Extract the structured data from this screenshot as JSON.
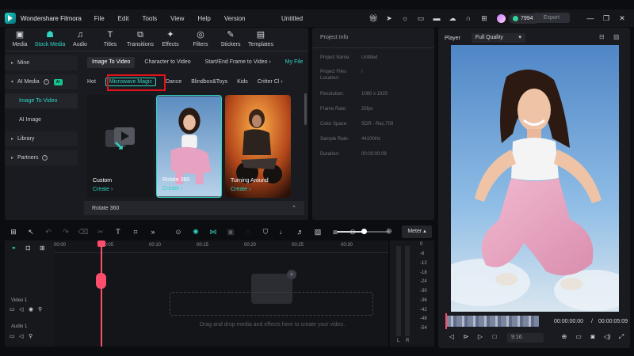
{
  "app": {
    "name": "Wondershare Filmora",
    "doc_title": "Untitled",
    "credits": "79943",
    "export_label": "Export"
  },
  "menu": [
    "File",
    "Edit",
    "Tools",
    "View",
    "Help",
    "Version"
  ],
  "toolbar_tabs": [
    {
      "label": "Media",
      "icon": "media-icon",
      "glyph": "▣"
    },
    {
      "label": "Stock Media",
      "icon": "stock-media-icon",
      "glyph": "☗"
    },
    {
      "label": "Audio",
      "icon": "audio-icon",
      "glyph": "♫"
    },
    {
      "label": "Titles",
      "icon": "titles-icon",
      "glyph": "T"
    },
    {
      "label": "Transitions",
      "icon": "transitions-icon",
      "glyph": "⧉"
    },
    {
      "label": "Effects",
      "icon": "effects-icon",
      "glyph": "✦"
    },
    {
      "label": "Filters",
      "icon": "filters-icon",
      "glyph": "◎"
    },
    {
      "label": "Stickers",
      "icon": "stickers-icon",
      "glyph": "✎"
    },
    {
      "label": "Templates",
      "icon": "templates-icon",
      "glyph": "▤"
    }
  ],
  "side_nav": {
    "mine": "Mine",
    "ai_media": "AI Media",
    "ai_badge": "AI",
    "image_to_video": "Image To Video",
    "ai_image": "AI Image",
    "library": "Library",
    "partners": "Partners"
  },
  "sub_tabs": [
    "Image To Video",
    "Character to Video",
    "Start/End Frame to Video",
    "My File"
  ],
  "categories": [
    "Hot",
    "Microwave Magic",
    "Dance",
    "Blindbox&Toys",
    "Kids",
    "Critter Cl"
  ],
  "cards": [
    {
      "name": "Custom",
      "action": "Create"
    },
    {
      "name": "Rotate 360",
      "action": "Create"
    },
    {
      "name": "Turning Around",
      "action": "Create"
    }
  ],
  "bottom_strip": {
    "label": "Rotate 360"
  },
  "project_info": {
    "header": "Project Info",
    "rows": [
      {
        "k": "Project Name:",
        "v": "Untitled"
      },
      {
        "k": "Project Files Location:",
        "v": "/"
      },
      {
        "k": "Resolution:",
        "v": "1080 x 1920"
      },
      {
        "k": "Frame Rate:",
        "v": "25fps"
      },
      {
        "k": "Color Space:",
        "v": "SDR - Rec.709"
      },
      {
        "k": "Sample Rate:",
        "v": "44100Hz"
      },
      {
        "k": "Duration:",
        "v": "00:00:00:09"
      }
    ]
  },
  "player": {
    "label": "Player",
    "quality": "Full Quality",
    "current_tc": "00:00:00:00",
    "separator": "/",
    "total_tc": "00:00:05:09",
    "ratio": "9:16"
  },
  "timeline": {
    "ruler": [
      "00:00",
      "00:05",
      "00:10",
      "00:15",
      "00:20",
      "00:25",
      "00:30"
    ],
    "tracks": [
      {
        "label": "Video 1"
      },
      {
        "label": "Audio 1"
      }
    ],
    "drop_text": "Drag and drop media and effects here to create your video.",
    "meter_label": "Meter ▴"
  },
  "meter": {
    "values": [
      "0",
      "-6",
      "-12",
      "-18",
      "-24",
      "-30",
      "-36",
      "-42",
      "-48",
      "-54"
    ],
    "left": "L",
    "right": "R"
  },
  "colors": {
    "accent": "#2fd5c3",
    "playhead": "#ff4d6d",
    "highlight": "#e1121a"
  }
}
